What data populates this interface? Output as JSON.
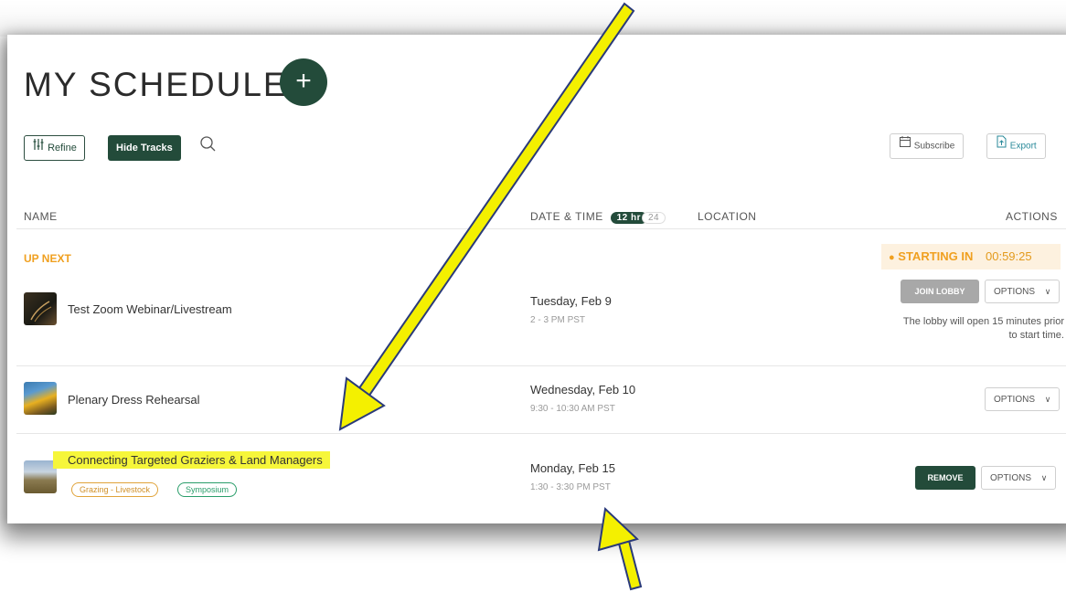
{
  "page": {
    "title": "MY SCHEDULE"
  },
  "toolbar": {
    "refine_label": "Refine",
    "hide_tracks_label": "Hide Tracks",
    "subscribe_label": "Subscribe",
    "export_label": "Export"
  },
  "table": {
    "headers": {
      "name": "NAME",
      "date_time": "DATE & TIME",
      "location": "LOCATION",
      "actions": "ACTIONS"
    },
    "time_format": {
      "option_12": "12 hr",
      "option_24": "24",
      "selected": "12 hr"
    }
  },
  "up_next": {
    "label": "UP NEXT",
    "starting_label": "STARTING IN",
    "countdown": "00:59:25"
  },
  "events": [
    {
      "name": "Test Zoom Webinar/Livestream",
      "date": "Tuesday, Feb 9",
      "time": "2 - 3 PM PST",
      "join_label": "JOIN LOBBY",
      "options_label": "OPTIONS",
      "note": "The lobby will open 15 minutes prior to start time."
    },
    {
      "name": "Plenary Dress Rehearsal",
      "date": "Wednesday, Feb 10",
      "time": "9:30 - 10:30 AM PST",
      "options_label": "OPTIONS"
    },
    {
      "name": "Connecting Targeted Graziers & Land Managers",
      "date": "Monday, Feb 15",
      "time": "1:30 - 3:30 PM PST",
      "tags": [
        "Grazing - Livestock",
        "Symposium"
      ],
      "remove_label": "REMOVE",
      "options_label": "OPTIONS"
    }
  ],
  "colors": {
    "brand_green": "#234b3a",
    "up_next_orange": "#f0a020",
    "highlight_yellow": "#f6f63a",
    "tag_grazing": "#e0a33a",
    "tag_symposium": "#2a9d6a"
  },
  "icons": [
    "plus-icon",
    "refine-sliders-icon",
    "search-icon",
    "calendar-icon",
    "export-icon",
    "chevron-down-icon"
  ]
}
